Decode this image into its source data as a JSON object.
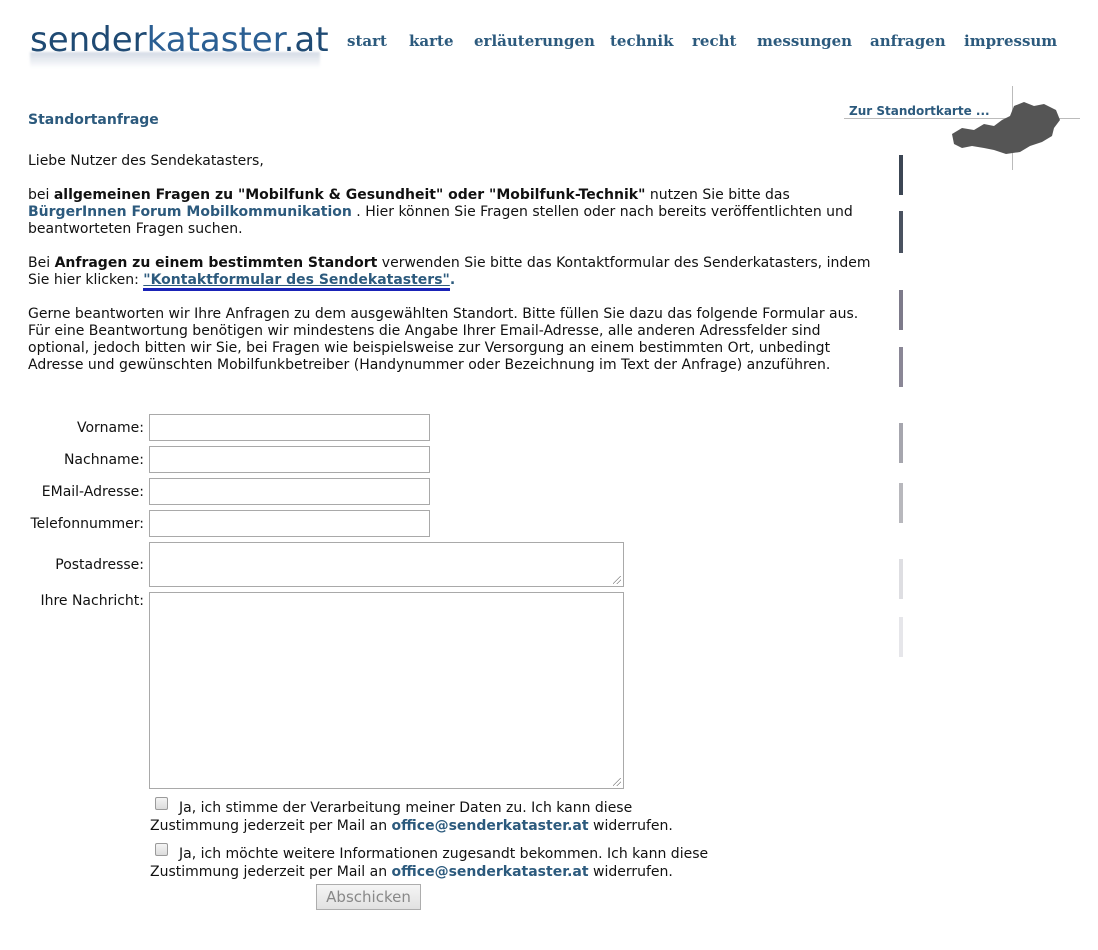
{
  "header": {
    "logo_part1": "sender",
    "logo_part2": "kataster",
    "logo_part3": ".at",
    "nav": [
      {
        "label": "start"
      },
      {
        "label": "karte"
      },
      {
        "label": "erläuterungen"
      },
      {
        "label": "technik"
      },
      {
        "label": "recht"
      },
      {
        "label": "messungen"
      },
      {
        "label": "anfragen"
      },
      {
        "label": "impressum"
      }
    ]
  },
  "map_teaser": {
    "label": "Zur Standortkarte ..."
  },
  "content": {
    "heading": "Standortanfrage",
    "greeting": "Liebe Nutzer des Sendekatasters,",
    "p1_a": "bei ",
    "p1_b": "allgemeinen Fragen zu \"Mobilfunk & Gesundheit\" oder \"Mobilfunk-Technik\"",
    "p1_c": " nutzen Sie bitte das ",
    "p1_link": "BürgerInnen Forum Mobilkommunikation",
    "p1_d": " . Hier können Sie Fragen stellen oder nach bereits veröffentlichten und beantworteten Fragen suchen.",
    "p2_a": "Bei ",
    "p2_b": "Anfragen zu einem bestimmten Standort",
    "p2_c": " verwenden Sie bitte das Kontaktformular des Senderkatasters, indem Sie hier klicken: ",
    "p2_link": "Kontaktformular des Sendekatasters",
    "p3": "Gerne beantworten wir Ihre Anfragen zu dem ausgewählten Standort. Bitte füllen Sie dazu das folgende Formular aus. Für eine Beantwortung benötigen wir mindestens die Angabe Ihrer Email-Adresse, alle anderen Adressfelder sind optional, jedoch bitten wir Sie, bei Fragen wie beispielsweise zur Versorgung an einem bestimmten Ort, unbedingt Adresse und gewünschten Mobilfunkbetreiber (Handynummer oder Bezeichnung im Text der Anfrage) anzuführen."
  },
  "form": {
    "vorname_label": "Vorname:",
    "vorname_value": "",
    "nachname_label": "Nachname:",
    "nachname_value": "",
    "email_label": "EMail-Adresse:",
    "email_value": "",
    "telefon_label": "Telefonnummer:",
    "telefon_value": "",
    "postadresse_label": "Postadresse:",
    "postadresse_value": "",
    "nachricht_label": "Ihre Nachricht:",
    "nachricht_value": "",
    "consent1_a": "Ja, ich stimme der Verarbeitung meiner Daten zu. Ich kann diese",
    "consent1_b": "Zustimmung jederzeit per Mail an ",
    "consent1_checked": false,
    "consent2_a": "Ja, ich möchte weitere Informationen zugesandt bekommen. Ich kann diese",
    "consent2_b": "Zustimmung jederzeit per Mail an ",
    "consent2_checked": false,
    "email_link": "office@senderkataster.at",
    "consent_end": " widerrufen.",
    "submit_label": "Abschicken"
  },
  "colors": {
    "brand": "#1f4a73",
    "link": "#2c5a7d",
    "underline": "#1a23b7"
  }
}
